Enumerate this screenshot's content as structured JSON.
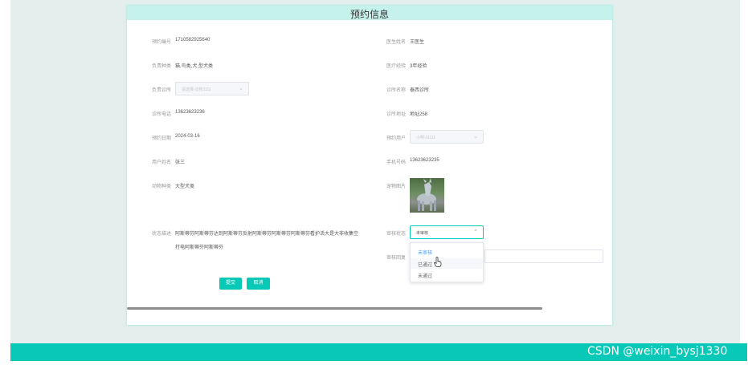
{
  "dialog": {
    "title": "预约信息"
  },
  "form": {
    "appointment_no": {
      "label": "预约编号",
      "value": "1710582925640"
    },
    "doctor_name": {
      "label": "医生姓名",
      "value": "王医生"
    },
    "responsible_types": {
      "label": "负责种类",
      "value": "猫,鸟类,犬,型犬类"
    },
    "medical_experience": {
      "label": "医疗经验",
      "value": "3年经验"
    },
    "responsible_clinic": {
      "label": "负责诊所",
      "placeholder": "请选择-诊所1111"
    },
    "clinic_name": {
      "label": "诊所名称",
      "value": "泰西诊所"
    },
    "clinic_phone": {
      "label": "诊所电话",
      "value": "13623623236"
    },
    "clinic_address": {
      "label": "诊所地址",
      "value": "地址258"
    },
    "appointment_date": {
      "label": "预约日期",
      "value": "2024-03-16"
    },
    "booking_user": {
      "label": "预约用户",
      "placeholder": "小明-11111"
    },
    "user_name": {
      "label": "用户姓名",
      "value": "张三"
    },
    "mobile": {
      "label": "手机号码",
      "value": "13623623235"
    },
    "pet_type": {
      "label": "动物种类",
      "value": "大型犬类"
    },
    "pet_photo": {
      "label": "宠物图片"
    },
    "symptom": {
      "label": "状态描述",
      "line1": "阿斯蒂芬阿斯蒂芬达到阿斯蒂芬反射阿斯蒂芬阿斯蒂芬阿斯蒂芬看护活大是大非收集空",
      "line2": "打电阿斯蒂芬阿斯蒂芬"
    },
    "review_status": {
      "label": "审核状态",
      "value": "未审核"
    },
    "review_remark": {
      "label": "审核回复"
    }
  },
  "dropdown": {
    "options": [
      "未审核",
      "已通过",
      "未通过"
    ],
    "selected_index": 0,
    "hover_index": 1
  },
  "buttons": {
    "submit": "提交",
    "cancel": "取消"
  },
  "footer": {
    "watermark": "CSDN @weixin_bysj1330"
  },
  "colors": {
    "accent": "#08c8b8",
    "header_bg": "#c6f2ec",
    "page_bg": "#e4efed",
    "selected_option": "#409eff"
  }
}
